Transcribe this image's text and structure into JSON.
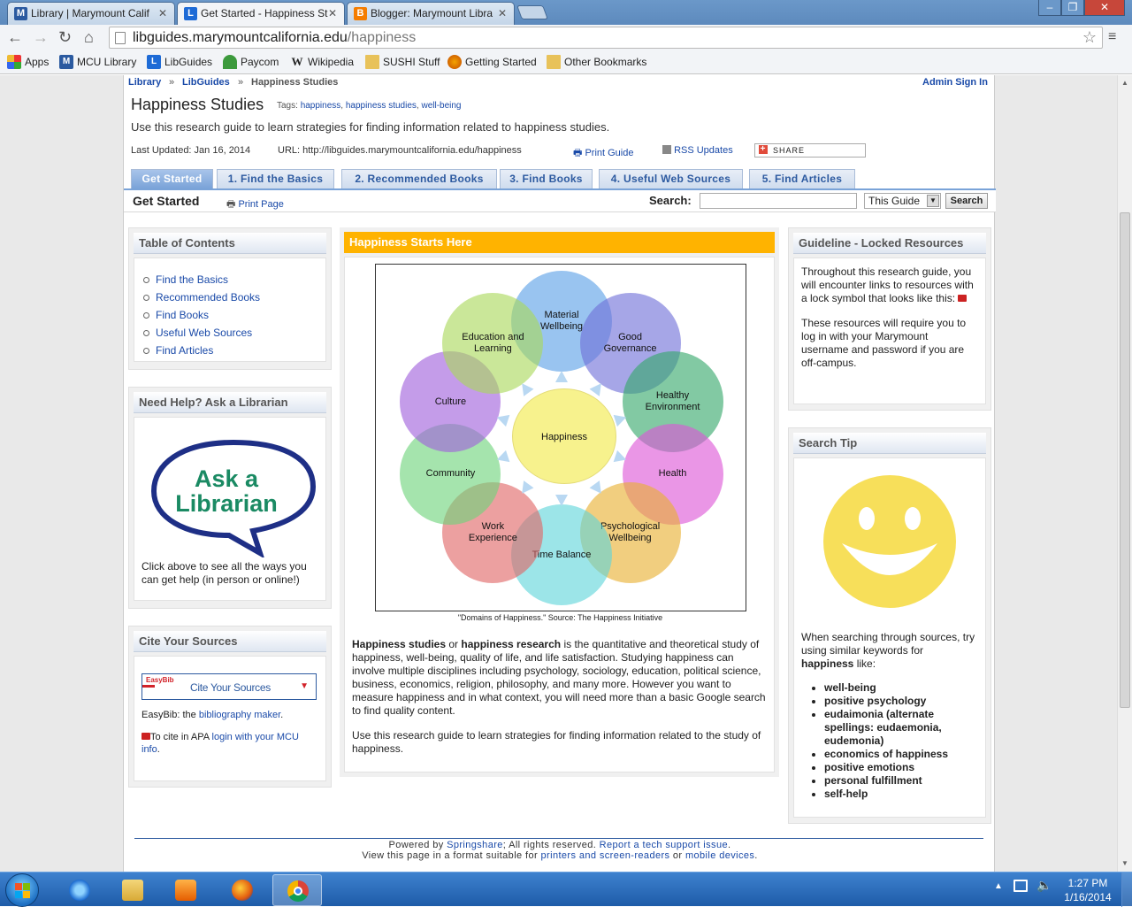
{
  "browser": {
    "tabs": [
      {
        "title": "Library | Marymount Calif",
        "icon": "M"
      },
      {
        "title": "Get Started - Happiness St",
        "icon": "L"
      },
      {
        "title": "Blogger: Marymount Libra",
        "icon": "B"
      }
    ],
    "url_host": "libguides.marymountcalifornia.edu",
    "url_path": "/happiness",
    "bookmarks": [
      "Apps",
      "MCU Library",
      "LibGuides",
      "Paycom",
      "Wikipedia",
      "SUSHI Stuff",
      "Getting Started",
      "Other Bookmarks"
    ]
  },
  "breadcrumb": {
    "library": "Library",
    "sep": "»",
    "libguides": "LibGuides",
    "current": "Happiness Studies",
    "admin": "Admin Sign In"
  },
  "guide": {
    "title": "Happiness Studies",
    "tags_label": "Tags:",
    "tags": [
      "happiness",
      "happiness studies",
      "well-being"
    ],
    "description": "Use this research guide to learn strategies for finding information related to happiness studies.",
    "last_updated": "Last Updated: Jan 16, 2014",
    "url_label": "URL:",
    "url": "http://libguides.marymountcalifornia.edu/happiness",
    "print_guide": "Print Guide",
    "rss": "RSS Updates",
    "share": "SHARE"
  },
  "page_tabs": [
    "Get Started",
    "1. Find the Basics",
    "2. Recommended Books",
    "3. Find Books",
    "4. Useful Web Sources",
    "5. Find Articles"
  ],
  "pagebar": {
    "name": "Get Started",
    "print_page": "Print Page",
    "search_label": "Search:",
    "scope": "This Guide",
    "search_button": "Search"
  },
  "toc": {
    "title": "Table of Contents",
    "items": [
      "Find the Basics",
      "Recommended Books",
      "Find Books",
      "Useful Web Sources",
      "Find Articles"
    ]
  },
  "help": {
    "title": "Need Help? Ask a Librarian",
    "logo_line1": "Ask a",
    "logo_line2": "Librarian",
    "text": "Click above to see all the ways you can get help (in person or online!)"
  },
  "cite": {
    "title": "Cite Your Sources",
    "easybib": "EasyBib",
    "widget_label": "Cite Your Sources",
    "line1_prefix": "EasyBib: the ",
    "line1_link": "bibliography maker",
    "line1_suffix": ".",
    "line2_prefix": "To cite in APA ",
    "line2_link": "login with your MCU info",
    "line2_suffix": "."
  },
  "center": {
    "title": "Happiness Starts Here",
    "center_label": "Happiness",
    "domains": [
      "Material Wellbeing",
      "Good Governance",
      "Healthy Environment",
      "Health",
      "Psychological Wellbeing",
      "Time Balance",
      "Work Experience",
      "Community",
      "Culture",
      "Education and Learning"
    ],
    "domain_lines": [
      [
        "Material",
        "Wellbeing"
      ],
      [
        "Good",
        "Governance"
      ],
      [
        "Healthy",
        "Environment"
      ],
      [
        "Health"
      ],
      [
        "Psychological",
        "Wellbeing"
      ],
      [
        "Time Balance"
      ],
      [
        "Work",
        "Experience"
      ],
      [
        "Community"
      ],
      [
        "Culture"
      ],
      [
        "Education and",
        "Learning"
      ]
    ],
    "domain_colors": [
      "#5aa0e6",
      "#6f6fd8",
      "#35a86a",
      "#dd55d6",
      "#e8b030",
      "#5fd5da",
      "#e06565",
      "#6ed47a",
      "#a060dc",
      "#a9d85a"
    ],
    "caption": "\"Domains of Happiness.\" Source: The Happiness Initiative",
    "p1_b1": "Happiness studies",
    "p1_t1": " or ",
    "p1_b2": "happiness research",
    "p1_rest": " is the quantitative and theoretical study of happiness, well-being, quality of life, and life satisfaction. Studying happiness can involve multiple disciplines including psychology, sociology, education, political science, business, economics, religion, philosophy, and many more. However you want to measure happiness and in what context, you will need more than a basic Google search to find quality content.",
    "p2": "Use this research guide to learn strategies for finding information related to the study of happiness."
  },
  "locked": {
    "title": "Guideline - Locked Resources",
    "p1": "Throughout this research guide, you will encounter links to resources with a lock symbol that looks like this: ",
    "p2": "These resources will require you to log in with your Marymount username and password if you are off-campus."
  },
  "tip": {
    "title": "Search Tip",
    "intro1": "When searching through sources, try using similar keywords for ",
    "intro_b": "happiness",
    "intro2": " like:",
    "items": [
      "well-being",
      "positive psychology",
      "eudaimonia (alternate spellings: eudaemonia, eudemonia)",
      "economics of happiness",
      "positive emotions",
      "personal fulfillment",
      "self-help"
    ]
  },
  "footer": {
    "powered": "Powered by ",
    "springshare": "Springshare",
    "rights": "; All rights reserved. ",
    "report": "Report a tech support issue",
    "dot": ".",
    "view": "View this page in a format suitable for ",
    "printers": "printers and screen-readers",
    "or": " or ",
    "mobile": "mobile devices",
    "dot2": "."
  },
  "taskbar": {
    "time": "1:27 PM",
    "date": "1/16/2014"
  }
}
